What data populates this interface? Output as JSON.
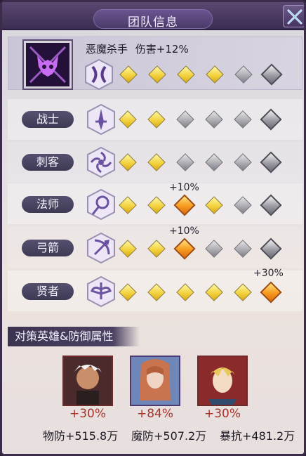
{
  "header": {
    "title": "团队信息"
  },
  "top_buff": {
    "name": "恶魔杀手",
    "effect": "伤害+12%"
  },
  "classes": [
    {
      "label": "战士",
      "icon": "warrior-icon"
    },
    {
      "label": "刺客",
      "icon": "assassin-icon"
    },
    {
      "label": "法师",
      "icon": "mage-icon",
      "bonus": "+10%"
    },
    {
      "label": "弓箭",
      "icon": "archer-icon",
      "bonus": "+10%"
    },
    {
      "label": "贤者",
      "icon": "sage-icon",
      "bonus": "+30%"
    }
  ],
  "section": {
    "title": "对策英雄&防御属性"
  },
  "heroes": [
    {
      "pct": "+30%",
      "stat": "物防+515.8万",
      "frame_color": "#c0392b"
    },
    {
      "pct": "+84%",
      "stat": "魔防+507.2万",
      "frame_color": "#7a5aa8"
    },
    {
      "pct": "+30%",
      "stat": "暴抗+481.2万",
      "frame_color": "#c0392b"
    }
  ]
}
